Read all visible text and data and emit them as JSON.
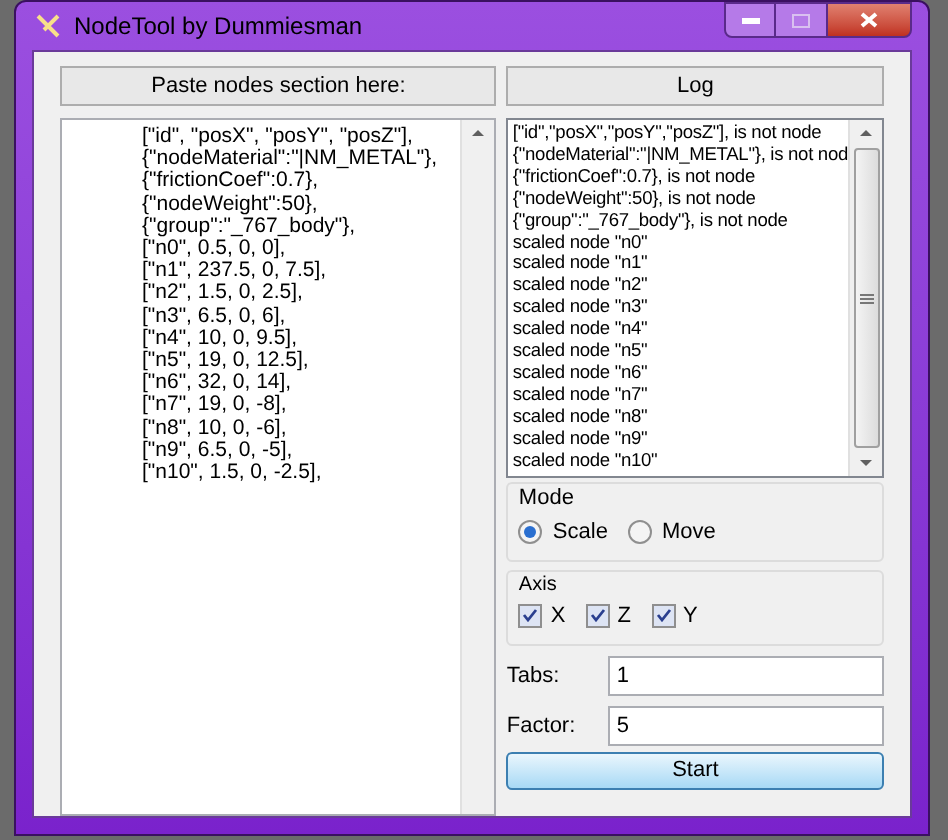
{
  "window": {
    "title": "NodeTool by Dummiesman"
  },
  "input_panel": {
    "header": "Paste nodes section here:",
    "lines": [
      "[\"id\", \"posX\", \"posY\", \"posZ\"],",
      "{\"nodeMaterial\":\"|NM_METAL\"},",
      "{\"frictionCoef\":0.7},",
      "{\"nodeWeight\":50},",
      "{\"group\":\"_767_body\"},",
      "[\"n0\", 0.5, 0, 0],",
      "[\"n1\", 237.5, 0, 7.5],",
      "[\"n2\", 1.5, 0, 2.5],",
      "[\"n3\", 6.5, 0, 6],",
      "[\"n4\", 10, 0, 9.5],",
      "[\"n5\", 19, 0, 12.5],",
      "[\"n6\", 32, 0, 14],",
      "[\"n7\", 19, 0, -8],",
      "[\"n8\", 10, 0, -6],",
      "[\"n9\", 6.5, 0, -5],",
      "[\"n10\", 1.5, 0, -2.5],"
    ]
  },
  "log_panel": {
    "header": "Log",
    "lines": [
      "[\"id\",\"posX\",\"posY\",\"posZ\"], is not node",
      "{\"nodeMaterial\":\"|NM_METAL\"}, is not nod",
      "{\"frictionCoef\":0.7}, is not node",
      "{\"nodeWeight\":50}, is not node",
      "{\"group\":\"_767_body\"}, is not node",
      "scaled node \"n0\"",
      "scaled node \"n1\"",
      "scaled node \"n2\"",
      "scaled node \"n3\"",
      "scaled node \"n4\"",
      "scaled node \"n5\"",
      "scaled node \"n6\"",
      "scaled node \"n7\"",
      "scaled node \"n8\"",
      "scaled node \"n9\"",
      "scaled node \"n10\""
    ]
  },
  "mode": {
    "title": "Mode",
    "options": [
      {
        "label": "Scale",
        "selected": true
      },
      {
        "label": "Move",
        "selected": false
      }
    ]
  },
  "axis": {
    "title": "Axis",
    "options": [
      {
        "label": "X",
        "checked": true
      },
      {
        "label": "Z",
        "checked": true
      },
      {
        "label": "Y",
        "checked": true
      }
    ]
  },
  "fields": [
    {
      "label": "Tabs:",
      "value": "1"
    },
    {
      "label": "Factor:",
      "value": "5"
    }
  ],
  "start_button": "Start"
}
